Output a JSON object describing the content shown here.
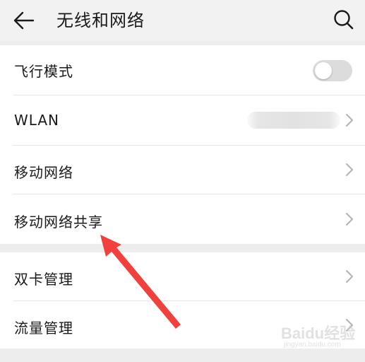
{
  "header": {
    "title": "无线和网络",
    "back_icon": "arrow-left-icon",
    "search_icon": "search-icon"
  },
  "settings": {
    "airplane_mode": {
      "label": "飞行模式",
      "toggle_on": false
    },
    "wlan": {
      "label": "WLAN"
    },
    "mobile_network": {
      "label": "移动网络"
    },
    "tethering": {
      "label": "移动网络共享"
    },
    "dual_sim": {
      "label": "双卡管理"
    },
    "data_usage": {
      "label": "流量管理"
    }
  },
  "annotation": {
    "arrow_color": "#f0413c"
  },
  "watermark": {
    "text": "Baidu经验",
    "sub": "jingyan.baidu.com"
  },
  "colors": {
    "background": "#ededed",
    "card": "#ffffff",
    "toggle_off": "#dcdcdc",
    "chevron": "#b3b3b3"
  }
}
